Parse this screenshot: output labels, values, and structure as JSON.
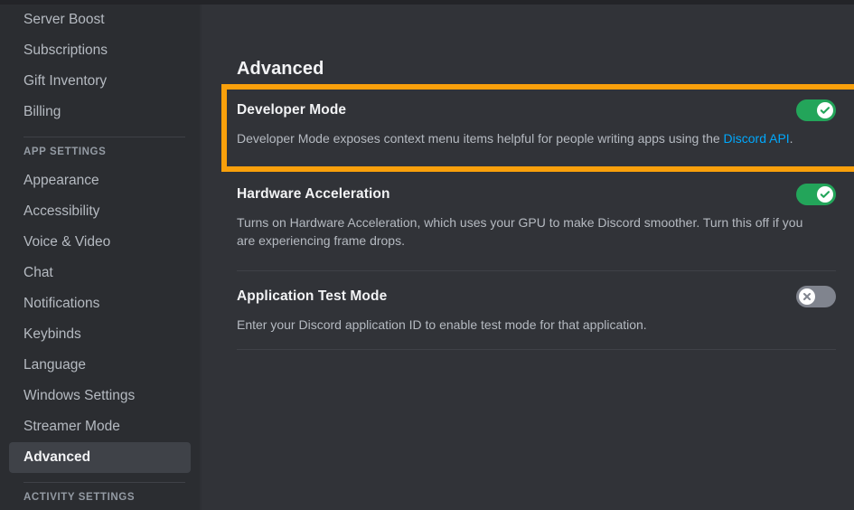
{
  "sidebar": {
    "items": [
      {
        "label": "Server Boost",
        "selected": false,
        "type": "item"
      },
      {
        "label": "Subscriptions",
        "selected": false,
        "type": "item"
      },
      {
        "label": "Gift Inventory",
        "selected": false,
        "type": "item"
      },
      {
        "label": "Billing",
        "selected": false,
        "type": "item"
      },
      {
        "label": "",
        "type": "divider"
      },
      {
        "label": "APP SETTINGS",
        "type": "header"
      },
      {
        "label": "Appearance",
        "selected": false,
        "type": "item"
      },
      {
        "label": "Accessibility",
        "selected": false,
        "type": "item"
      },
      {
        "label": "Voice & Video",
        "selected": false,
        "type": "item"
      },
      {
        "label": "Chat",
        "selected": false,
        "type": "item"
      },
      {
        "label": "Notifications",
        "selected": false,
        "type": "item"
      },
      {
        "label": "Keybinds",
        "selected": false,
        "type": "item"
      },
      {
        "label": "Language",
        "selected": false,
        "type": "item"
      },
      {
        "label": "Windows Settings",
        "selected": false,
        "type": "item"
      },
      {
        "label": "Streamer Mode",
        "selected": false,
        "type": "item"
      },
      {
        "label": "Advanced",
        "selected": true,
        "type": "item"
      },
      {
        "label": "",
        "type": "divider"
      },
      {
        "label": "ACTIVITY SETTINGS",
        "type": "header"
      }
    ]
  },
  "main": {
    "page_title": "Advanced",
    "settings": [
      {
        "title": "Developer Mode",
        "desc_before": "Developer Mode exposes context menu items helpful for people writing apps using the ",
        "link_text": "Discord API",
        "desc_after": ".",
        "toggle_state": "on",
        "highlighted": true
      },
      {
        "title": "Hardware Acceleration",
        "desc_before": "Turns on Hardware Acceleration, which uses your GPU to make Discord smoother. Turn this off if you are experiencing frame drops.",
        "link_text": "",
        "desc_after": "",
        "toggle_state": "on",
        "highlighted": false
      },
      {
        "title": "Application Test Mode",
        "desc_before": "Enter your Discord application ID to enable test mode for that application.",
        "link_text": "",
        "desc_after": "",
        "toggle_state": "off",
        "highlighted": false
      }
    ]
  },
  "colors": {
    "highlight_border": "#f9a00b",
    "toggle_on": "#23a55a",
    "toggle_off": "#80848e",
    "link": "#00a8fc",
    "sidebar_bg": "#2b2d31",
    "content_bg": "#313338",
    "selected_bg": "#3f4248"
  }
}
